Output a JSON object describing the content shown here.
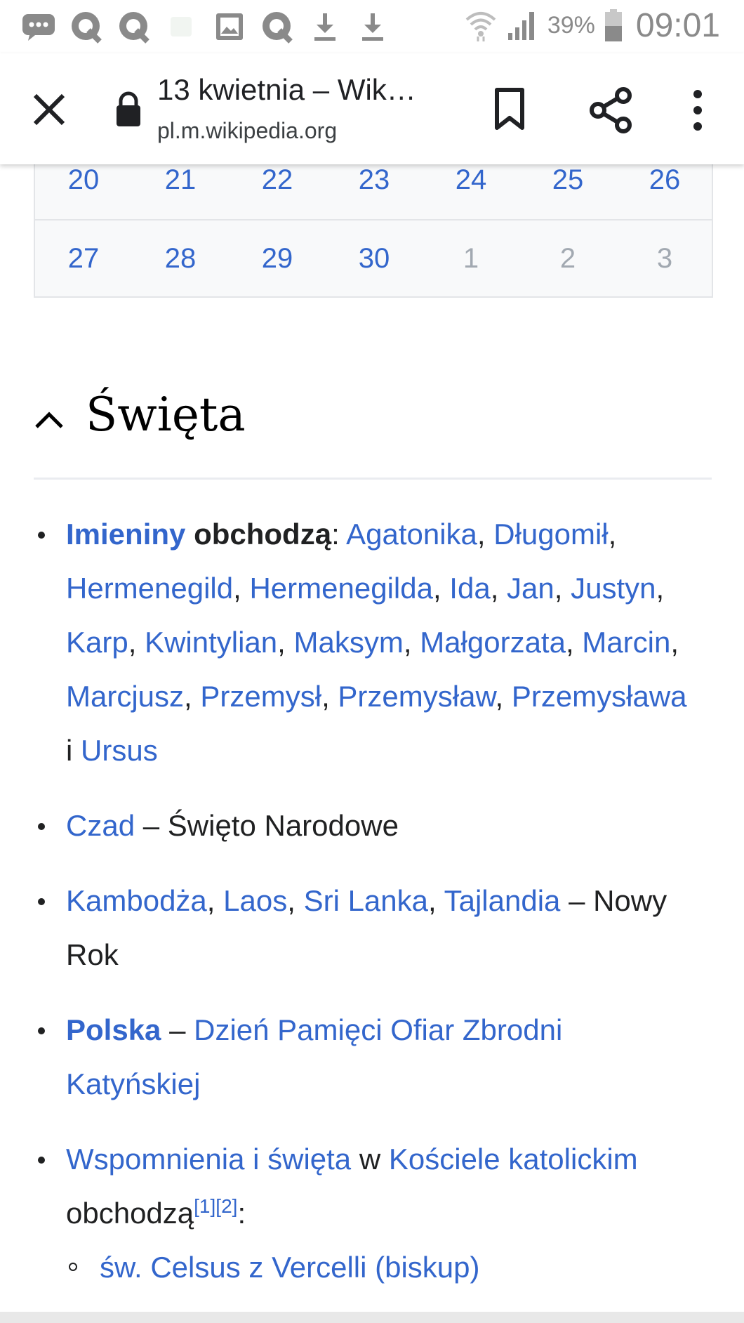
{
  "status_bar": {
    "icons": [
      "message-icon",
      "q-app-icon",
      "q-app-icon",
      "image-icon",
      "q-app-icon",
      "download-icon",
      "download-icon",
      "wifi-icon",
      "signal-icon",
      "battery-icon"
    ],
    "battery": "39%",
    "time": "09:01"
  },
  "toolbar": {
    "title": "13 kwietnia – Wik…",
    "url": "pl.m.wikipedia.org"
  },
  "calendar": {
    "rows": [
      [
        "20",
        "21",
        "22",
        "23",
        "24",
        "25",
        "26"
      ],
      [
        "27",
        "28",
        "29",
        "30",
        "1",
        "2",
        "3"
      ]
    ],
    "greyed_from_row2_index": 4
  },
  "section": {
    "title": "Święta"
  },
  "list": {
    "imieniny": {
      "label": "Imieniny",
      "suffix": "obchodzą",
      "names": [
        "Agatonika",
        "Długomił",
        "Hermenegild",
        "Hermenegilda",
        "Ida",
        "Jan",
        "Justyn",
        "Karp",
        "Kwintylian",
        "Maksym",
        "Małgorzata",
        "Marcin",
        "Marcjusz",
        "Przemysł",
        "Przemysław",
        "Przemysława",
        "Ursus"
      ],
      "conjunction": "i"
    },
    "czad": {
      "link": "Czad",
      "text": "– Święto Narodowe"
    },
    "nowy_rok": {
      "links": [
        "Kambodża",
        "Laos",
        "Sri Lanka",
        "Tajlandia"
      ],
      "text": "– Nowy Rok"
    },
    "polska": {
      "link": "Polska",
      "dash": "–",
      "event": "Dzień Pamięci Ofiar Zbrodni Katyńskiej"
    },
    "wspomnienia": {
      "link1": "Wspomnienia i święta",
      "w": "w",
      "link2": "Kościele katolickim",
      "text": "obchodzą",
      "ref1": "[1]",
      "ref2": "[2]",
      "colon": ":"
    },
    "sub_items": [
      "św. Celsus z Vercelli (biskup)"
    ]
  }
}
